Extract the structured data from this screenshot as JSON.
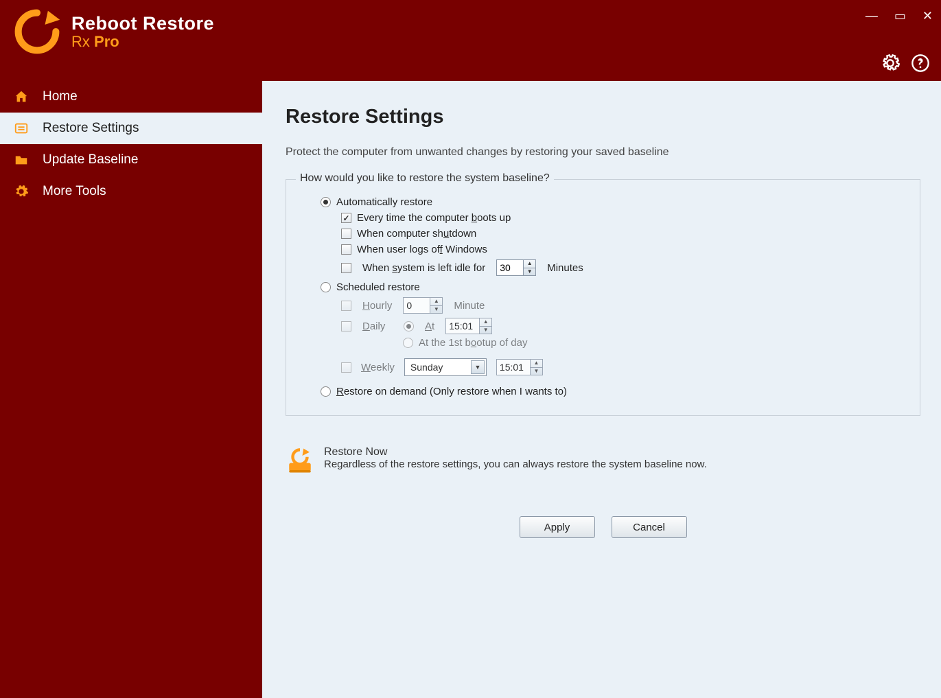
{
  "app": {
    "logo_line1": "Reboot Restore",
    "logo_rx": "Rx",
    "logo_pro": "Pro"
  },
  "sidebar": {
    "items": [
      {
        "label": "Home"
      },
      {
        "label": "Restore Settings"
      },
      {
        "label": "Update Baseline"
      },
      {
        "label": "More Tools"
      }
    ]
  },
  "page": {
    "title": "Restore Settings",
    "subtitle": "Protect the computer from unwanted changes by restoring your saved baseline",
    "legend": "How would you like to restore the system baseline?"
  },
  "opts": {
    "auto": "Automatically restore",
    "boot_pre": "Every time the computer ",
    "boot_u": "b",
    "boot_post": "oots up",
    "shutdown_pre": "When computer sh",
    "shutdown_u": "u",
    "shutdown_post": "tdown",
    "logoff_pre": "When user logs of",
    "logoff_u": "f",
    "logoff_post": " Windows",
    "idle_pre": "When ",
    "idle_u": "s",
    "idle_post": "ystem is left idle for",
    "idle_value": "30",
    "idle_unit": "Minutes",
    "scheduled": "Scheduled restore",
    "hourly_u": "H",
    "hourly_post": "ourly",
    "hourly_value": "0",
    "hourly_unit": "Minute",
    "daily_u": "D",
    "daily_post": "aily",
    "at_u": "A",
    "at_post": "t",
    "daily_time": "15:01",
    "firstboot_pre": "At the 1st b",
    "firstboot_u": "o",
    "firstboot_post": "otup of day",
    "weekly_u": "W",
    "weekly_post": "eekly",
    "weekly_day": "Sunday",
    "weekly_time": "15:01",
    "ondemand_u": "R",
    "ondemand_post": "estore on demand (Only restore when I wants to)"
  },
  "restore_now": {
    "title_pre": "Restore ",
    "title_u": "N",
    "title_post": "ow",
    "subtitle": "Regardless of the restore settings, you can always restore the system baseline now."
  },
  "buttons": {
    "apply_pre": "Appl",
    "apply_u": "y",
    "cancel_u": "C",
    "cancel_post": "ancel"
  }
}
